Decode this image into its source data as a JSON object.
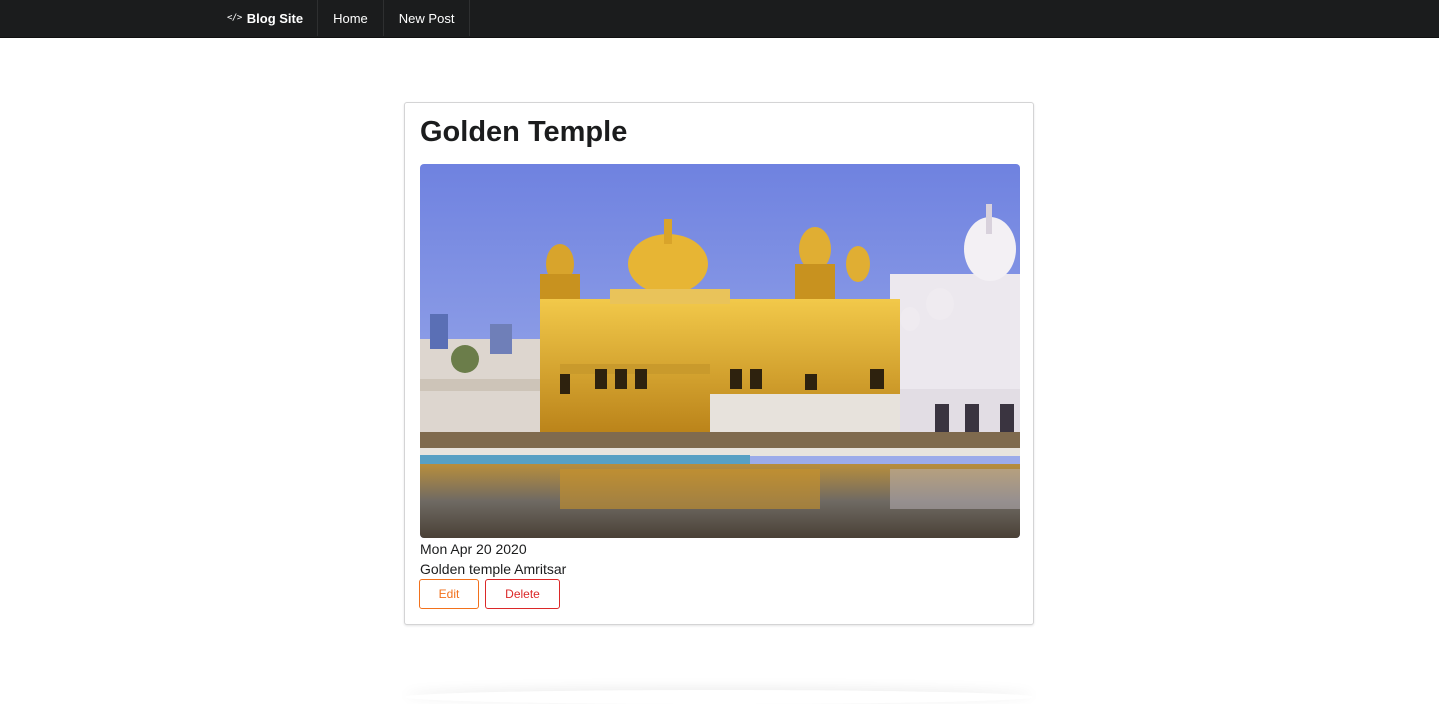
{
  "nav": {
    "brand": "Blog Site",
    "brand_icon": "code-icon",
    "items": [
      {
        "label": "Home"
      },
      {
        "label": "New Post"
      }
    ]
  },
  "post": {
    "title": "Golden Temple",
    "image_subject": "golden-temple-photo",
    "date": "Mon Apr 20 2020",
    "body": "Golden temple Amritsar",
    "edit_label": "Edit",
    "delete_label": "Delete"
  },
  "colors": {
    "nav_bg": "#1b1c1d",
    "edit": "#f2711c",
    "delete": "#db2828"
  }
}
